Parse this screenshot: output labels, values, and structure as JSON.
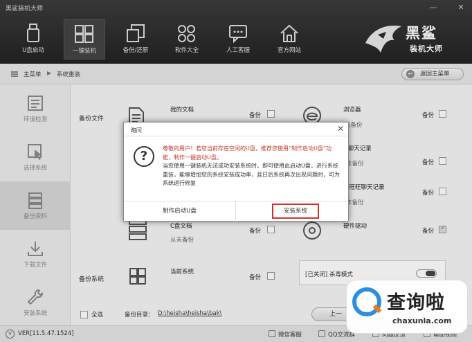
{
  "app": {
    "title": "黑鲨装机大师",
    "brand_name": "黑鲨",
    "brand_sub": "装机大师"
  },
  "nav": [
    {
      "label": "U盘启动",
      "icon": "usb-drive-icon"
    },
    {
      "label": "一键装机",
      "icon": "windows-icon",
      "active": true
    },
    {
      "label": "备份/还原",
      "icon": "backup-restore-icon"
    },
    {
      "label": "软件大全",
      "icon": "apps-grid-icon"
    },
    {
      "label": "人工客服",
      "icon": "chat-bubble-icon"
    },
    {
      "label": "官方网站",
      "icon": "home-icon"
    }
  ],
  "breadcrumb": {
    "home": "主菜单",
    "current": "系统重装",
    "back_button": "返回主菜单"
  },
  "sidebar": [
    {
      "label": "环境检测",
      "icon": "checklist-icon"
    },
    {
      "label": "选择系统",
      "icon": "cursor-icon"
    },
    {
      "label": "备份资料",
      "icon": "database-icon",
      "active": true
    },
    {
      "label": "下载文件",
      "icon": "download-icon"
    },
    {
      "label": "安装系统",
      "icon": "wrench-icon"
    }
  ],
  "backup_files": {
    "title": "备份文件",
    "items": [
      {
        "name": "我的文档",
        "status": "",
        "check_label": "备份",
        "checked": false
      },
      {
        "name": "浏览器",
        "status": "未备份",
        "check_label": "备份",
        "checked": false
      },
      {
        "name": "Q聊天记录",
        "status": "未备份",
        "check_label": "备份",
        "checked": false
      },
      {
        "name": "里旺旺聊天记录",
        "status": "未备份",
        "check_label": "备份",
        "checked": false
      },
      {
        "name": "C盘文档",
        "status": "从未备份",
        "check_label": "备份",
        "checked": false
      },
      {
        "name": "硬件驱动",
        "status": "",
        "check_label": "备份",
        "checked": true
      }
    ]
  },
  "backup_system": {
    "title": "备份系统",
    "current_label": "当前系统",
    "check_label": "备份",
    "safe_mode_label": "[已关闭] 杀毒模式"
  },
  "footer": {
    "select_all": "全选",
    "path_label": "备份目录：",
    "path": "D:\\heisha\\heisha\\bak\\",
    "prev_button": "上一"
  },
  "status": {
    "version": "VER[11.5.47.1524]",
    "links": [
      "微信客服",
      "QQ交流群",
      "问题反馈",
      "帮助视频"
    ]
  },
  "dialog": {
    "title": "询问",
    "msg_red": "尊敬的用户！若您当前存在空闲的U盘，推荐您使用“制作启动U盘”功能，制作一键启动U盘。",
    "msg_black": "当您使用一键装机无法成功安装系统时，即可使用此启动U盘，进行系统重装，能够增加您的系统安装成功率，且日后系统再次出现问题时，可为系统进行修复",
    "btn_left": "制作启动U盘",
    "btn_right": "安装系统"
  },
  "watermark": {
    "text": "查询啦",
    "url": "chaxunla.com"
  }
}
